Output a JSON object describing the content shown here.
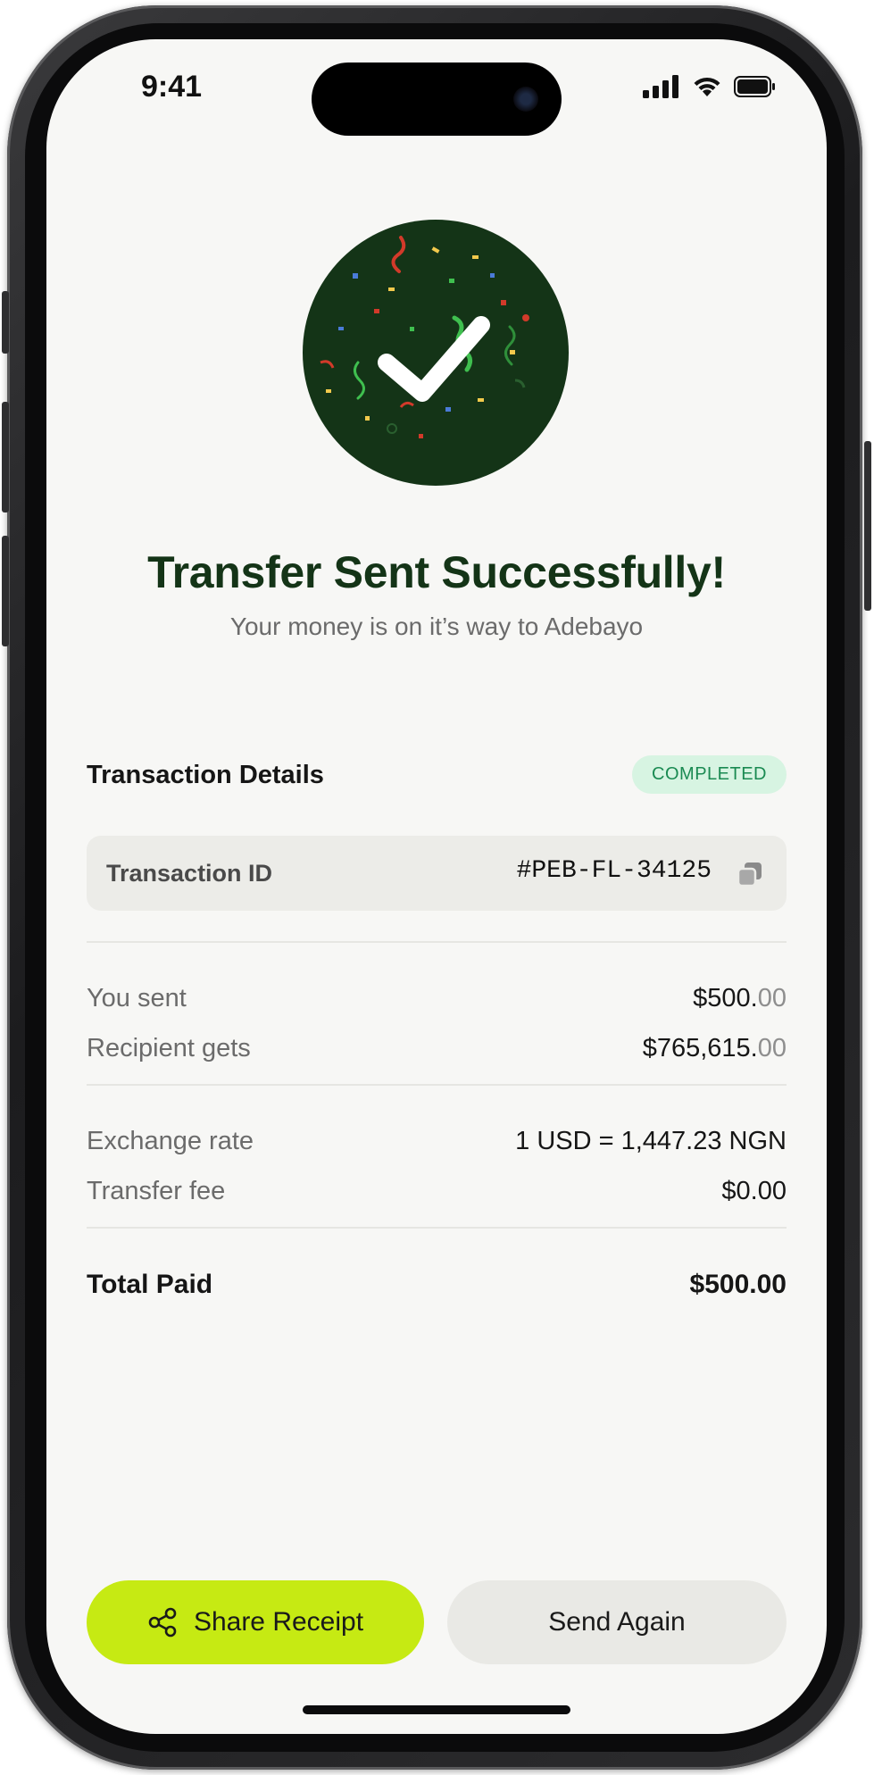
{
  "status_bar": {
    "time": "9:41"
  },
  "hero": {
    "icon": "check-confetti-icon",
    "background_color": "#143417"
  },
  "header": {
    "title": "Transfer Sent Successfully!",
    "subtitle": "Your money is on it’s way to Adebayo"
  },
  "transaction": {
    "section_title": "Transaction Details",
    "status_badge": "COMPLETED",
    "id_label": "Transaction ID",
    "id_value": "#PEB-FL-34125"
  },
  "amounts": {
    "you_sent_label": "You sent",
    "you_sent_main": "$500.",
    "you_sent_decimal": "00",
    "recipient_gets_label": "Recipient gets",
    "recipient_gets_main": "$765,615.",
    "recipient_gets_decimal": "00"
  },
  "rates": {
    "exchange_rate_label": "Exchange rate",
    "exchange_rate_value": "1 USD = 1,447.23 NGN",
    "transfer_fee_label": "Transfer fee",
    "transfer_fee_value": "$0.00"
  },
  "total": {
    "label": "Total Paid",
    "value": "$500.00"
  },
  "actions": {
    "share_label": "Share Receipt",
    "send_again_label": "Send Again"
  },
  "colors": {
    "accent_lime": "#c6ea13",
    "dark_green": "#143417",
    "badge_bg": "#d7f4e2",
    "badge_text": "#1a8a52"
  }
}
